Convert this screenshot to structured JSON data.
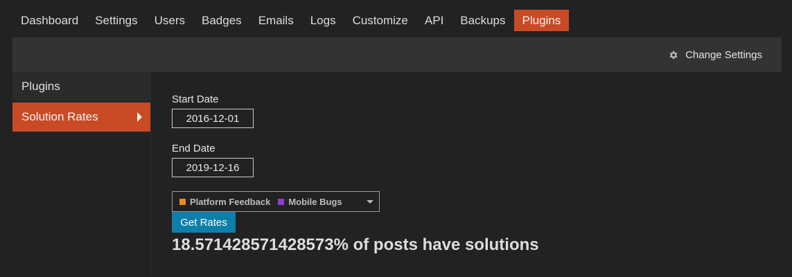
{
  "topnav": {
    "tabs": [
      {
        "label": "Dashboard"
      },
      {
        "label": "Settings"
      },
      {
        "label": "Users"
      },
      {
        "label": "Badges"
      },
      {
        "label": "Emails"
      },
      {
        "label": "Logs"
      },
      {
        "label": "Customize"
      },
      {
        "label": "API"
      },
      {
        "label": "Backups"
      },
      {
        "label": "Plugins"
      }
    ],
    "active": "Plugins"
  },
  "subbar": {
    "change_settings_label": "Change Settings",
    "icon": "gear-icon"
  },
  "sidebar": {
    "items": [
      {
        "label": "Plugins"
      },
      {
        "label": "Solution Rates"
      }
    ],
    "active": "Solution Rates"
  },
  "form": {
    "start_date_label": "Start Date",
    "start_date_value": "2016-12-01",
    "end_date_label": "End Date",
    "end_date_value": "2019-12-16",
    "categories": [
      {
        "name": "Platform Feedback",
        "color": "#f08a1c"
      },
      {
        "name": "Mobile Bugs",
        "color": "#8d3bd0"
      }
    ],
    "get_rates_label": "Get Rates"
  },
  "result": {
    "text": "18.571428571428573% of posts have solutions"
  },
  "colors": {
    "accent": "#c84b26",
    "button": "#0e7fab",
    "background": "#222222",
    "subbar": "#333333"
  }
}
